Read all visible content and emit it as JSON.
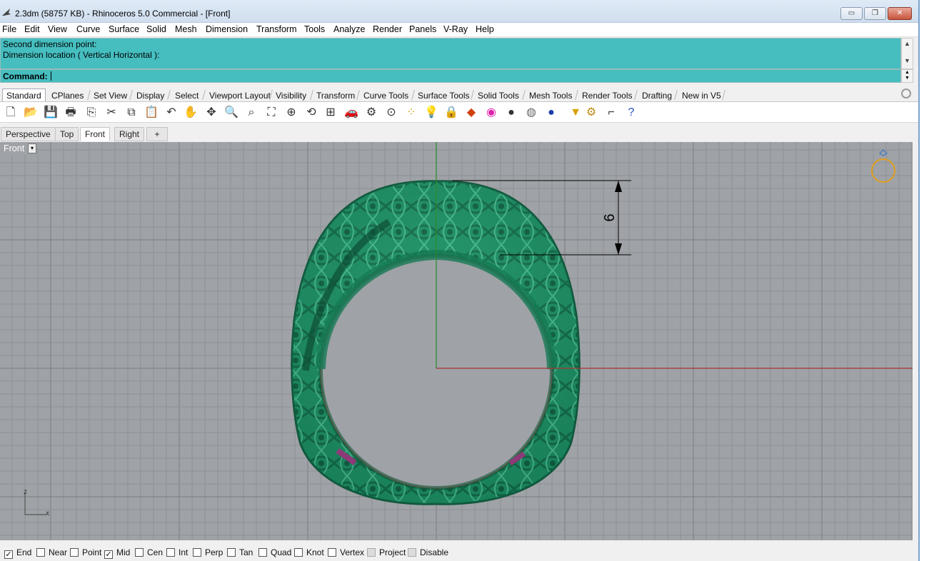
{
  "window": {
    "title": "2.3dm (58757 KB) - Rhinoceros 5.0 Commercial - [Front]",
    "minimize": "▭",
    "restore": "❐",
    "close": "✕"
  },
  "menu": [
    "File",
    "Edit",
    "View",
    "Curve",
    "Surface",
    "Solid",
    "Mesh",
    "Dimension",
    "Transform",
    "Tools",
    "Analyze",
    "Render",
    "Panels",
    "V-Ray",
    "Help"
  ],
  "command": {
    "history": [
      "Second dimension point:",
      "Dimension location ( Vertical  Horizontal ):"
    ],
    "prompt": "Command:"
  },
  "toolbar_tabs": [
    "Standard",
    "CPlanes",
    "Set View",
    "Display",
    "Select",
    "Viewport Layout",
    "Visibility",
    "Transform",
    "Curve Tools",
    "Surface Tools",
    "Solid Tools",
    "Mesh Tools",
    "Render Tools",
    "Drafting",
    "New in V5"
  ],
  "active_toolbar_tab": "Standard",
  "toolbar_icons": [
    "new-icon",
    "open-icon",
    "save-icon",
    "print-icon",
    "import-icon",
    "cut-icon",
    "copy-icon",
    "paste-icon",
    "undo-icon",
    "pan-icon",
    "rotate-view-icon",
    "zoom-icon",
    "zoom-window-icon",
    "zoom-extents-icon",
    "zoom-selected-icon",
    "rotate-icon",
    "four-viewports-icon",
    "car-icon",
    "properties-icon",
    "osnap-icon",
    "point-icon",
    "light-icon",
    "lock-icon",
    "layer-icon",
    "color-wheel-icon",
    "shade-icon",
    "render-preview-icon",
    "render-icon",
    "select-filter-icon",
    "options-icon",
    "dimension-icon",
    "help-icon"
  ],
  "viewport_tabs": [
    "Perspective",
    "Top",
    "Front",
    "Right",
    "+"
  ],
  "active_viewport": "Front",
  "viewport": {
    "label": "Front",
    "dimension_value": "6",
    "axis_z": "z",
    "axis_x": "x",
    "colors": {
      "background": "#9fa2a6",
      "grid": "#8d9094",
      "major_grid": "#7a7d81",
      "x_axis": "#a83434",
      "y_axis": "#2a8a2a",
      "model": "#1f8a63"
    }
  },
  "osnaps": [
    {
      "label": "End",
      "checked": true
    },
    {
      "label": "Near",
      "checked": false
    },
    {
      "label": "Point",
      "checked": false
    },
    {
      "label": "Mid",
      "checked": true
    },
    {
      "label": "Cen",
      "checked": false
    },
    {
      "label": "Int",
      "checked": false
    },
    {
      "label": "Perp",
      "checked": false
    },
    {
      "label": "Tan",
      "checked": false
    },
    {
      "label": "Quad",
      "checked": false
    },
    {
      "label": "Knot",
      "checked": false
    },
    {
      "label": "Vertex",
      "checked": false
    },
    {
      "label": "Project",
      "checked": false,
      "disabled": true
    },
    {
      "label": "Disable",
      "checked": false,
      "disabled": true
    }
  ]
}
